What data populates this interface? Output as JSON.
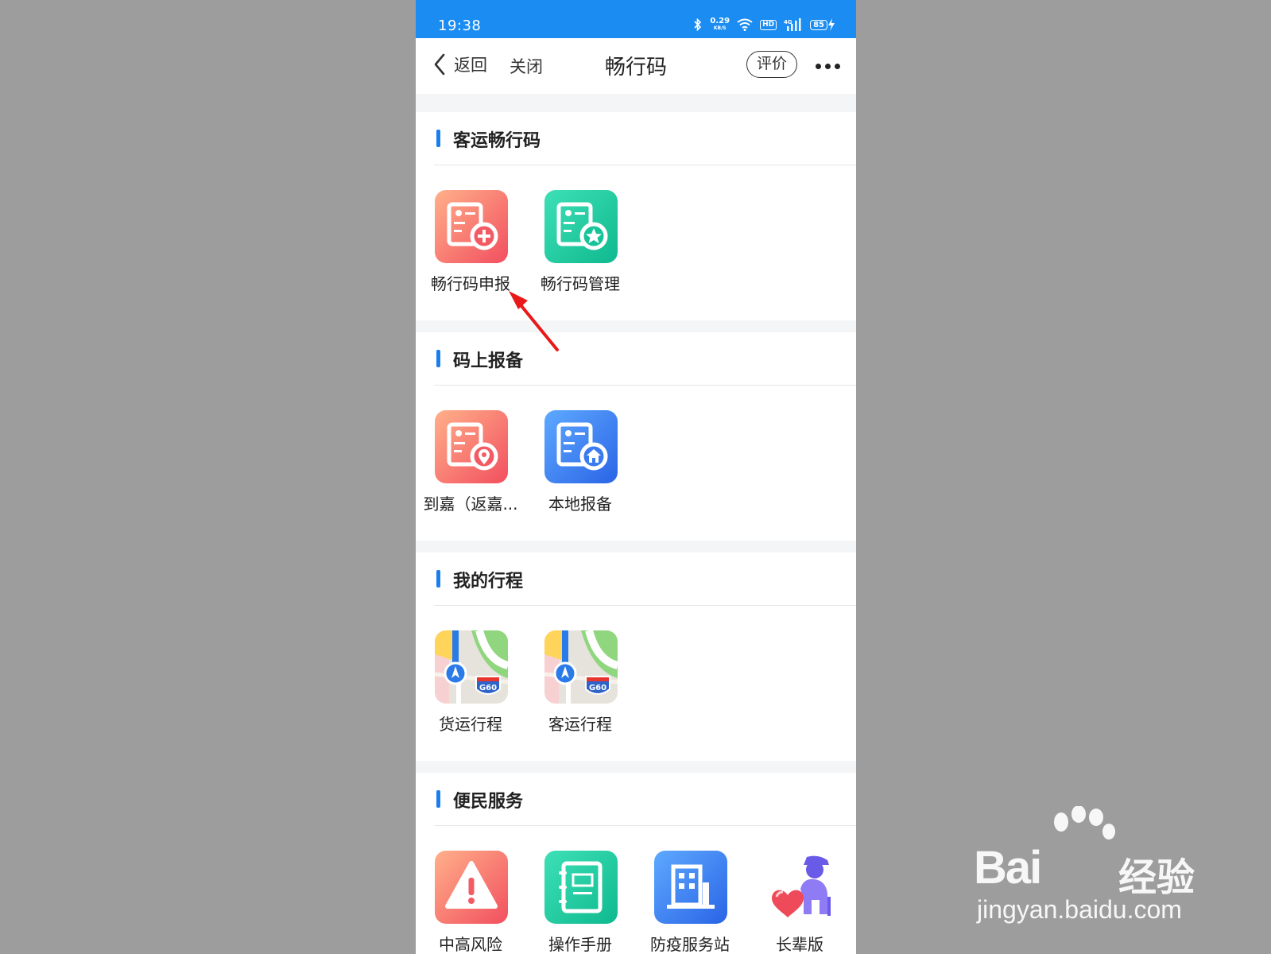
{
  "status_bar": {
    "time": "19:38",
    "net_speed": "0.29",
    "net_unit": "KB/S",
    "hd": "HD",
    "signal_label": "4G",
    "battery": "85"
  },
  "nav": {
    "back_label": "返回",
    "close_label": "关闭",
    "title": "畅行码",
    "rate_label": "评价"
  },
  "sections": [
    {
      "title": "客运畅行码",
      "items": [
        {
          "label": "畅行码申报",
          "icon": "id-card-plus-icon"
        },
        {
          "label": "畅行码管理",
          "icon": "id-card-star-icon"
        }
      ]
    },
    {
      "title": "码上报备",
      "items": [
        {
          "label": "到嘉（返嘉...",
          "icon": "id-card-location-icon"
        },
        {
          "label": "本地报备",
          "icon": "id-card-home-icon"
        }
      ]
    },
    {
      "title": "我的行程",
      "items": [
        {
          "label": "货运行程",
          "icon": "map-route-icon",
          "badge": "G60"
        },
        {
          "label": "客运行程",
          "icon": "map-route-icon",
          "badge": "G60"
        }
      ]
    },
    {
      "title": "便民服务",
      "items": [
        {
          "label": "中高风险",
          "icon": "warning-icon"
        },
        {
          "label": "操作手册",
          "icon": "manual-book-icon"
        },
        {
          "label": "防疫服务站",
          "icon": "building-icon"
        },
        {
          "label": "长辈版",
          "icon": "elder-heart-icon"
        }
      ]
    }
  ],
  "watermark": {
    "brand": "Bai",
    "brand_cn": "经验",
    "url": "jingyan.baidu.com"
  },
  "colors": {
    "status_bar": "#1a8cf2",
    "accent": "#1a7ef0",
    "arrow": "#e8191b",
    "background": "#9d9d9d"
  }
}
